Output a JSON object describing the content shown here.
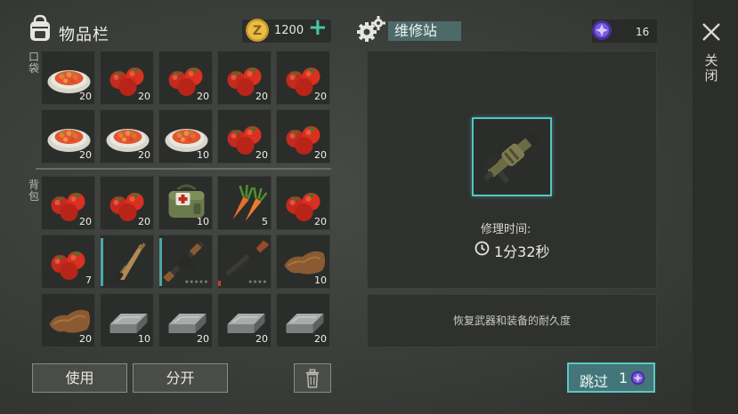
{
  "inventory": {
    "title": "物品栏",
    "coins": "1200",
    "pocket_label": "口袋",
    "backpack_label": "背包",
    "pocket_slots": [
      {
        "item": "salad",
        "count": "20"
      },
      {
        "item": "tomatoes",
        "count": "20"
      },
      {
        "item": "tomatoes",
        "count": "20"
      },
      {
        "item": "tomatoes",
        "count": "20"
      },
      {
        "item": "tomatoes",
        "count": "20"
      },
      {
        "item": "salad",
        "count": "20"
      },
      {
        "item": "salad",
        "count": "20"
      },
      {
        "item": "salad",
        "count": "10"
      },
      {
        "item": "tomatoes",
        "count": "20"
      },
      {
        "item": "tomatoes",
        "count": "20"
      }
    ],
    "backpack_slots": [
      {
        "item": "tomatoes",
        "count": "20"
      },
      {
        "item": "tomatoes",
        "count": "20"
      },
      {
        "item": "medkit-bag",
        "count": "10"
      },
      {
        "item": "carrots",
        "count": "5"
      },
      {
        "item": "tomatoes",
        "count": "20"
      },
      {
        "item": "tomatoes",
        "count": "7"
      },
      {
        "item": "machete",
        "count": ""
      },
      {
        "item": "assault-rifle",
        "count": "",
        "stars": "★★★★★"
      },
      {
        "item": "shotgun",
        "count": "",
        "stars": "★★★★"
      },
      {
        "item": "leather",
        "count": "10"
      },
      {
        "item": "leather",
        "count": "20"
      },
      {
        "item": "iron-ingot",
        "count": "10"
      },
      {
        "item": "iron-ingot",
        "count": "20"
      },
      {
        "item": "iron-ingot",
        "count": "20"
      },
      {
        "item": "iron-ingot",
        "count": "20"
      }
    ],
    "use_label": "使用",
    "split_label": "分开"
  },
  "repair": {
    "title": "维修站",
    "gems": "16",
    "item": "grenade-launcher",
    "time_label": "修理时间:",
    "time_value": "1分32秒",
    "description": "恢复武器和装备的耐久度",
    "skip_label": "跳过",
    "skip_cost": "1"
  },
  "close_label": "关闭",
  "colors": {
    "accent_teal": "#46c7a5",
    "title_bar": "#4d6a6a",
    "skip_button": "#43757a",
    "slot_highlight": "#53c7c0"
  }
}
